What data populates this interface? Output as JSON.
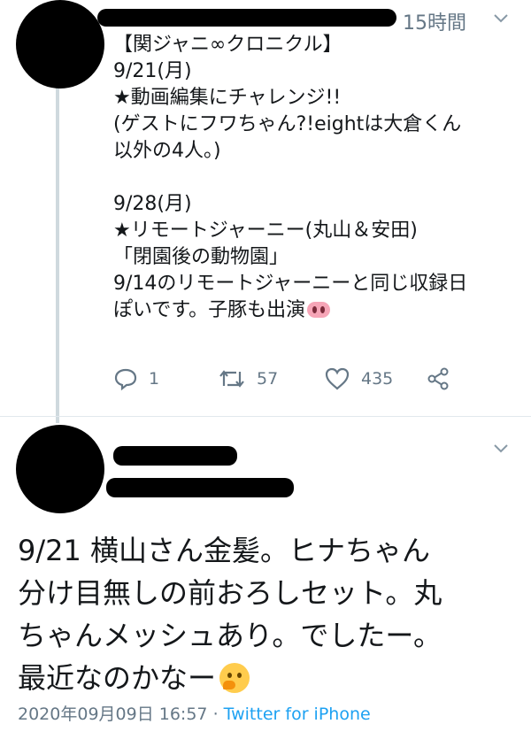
{
  "tweet1": {
    "timestamp": "15時間",
    "lines": [
      "【関ジャニ∞クロニクル】",
      "9/21(月)",
      "★動画編集にチャレンジ!!",
      "(ゲストにフワちゃん?!eightは大倉くん",
      "以外の4人。)",
      "",
      "9/28(月)",
      "★リモートジャーニー(丸山＆安田)",
      "「閉園後の動物園」",
      "9/14のリモートジャーニーと同じ収録日",
      "ぽいです。子豚も出演"
    ],
    "emoji_last_line": "pig-nose",
    "actions": {
      "reply_count": "1",
      "retweet_count": "57",
      "like_count": "435"
    }
  },
  "tweet2": {
    "lines": [
      "9/21 横山さん金髪。ヒナちゃん",
      "分け目無しの前おろしセット。丸",
      "ちゃんメッシュあり。でしたー。",
      "最近なのかなー"
    ],
    "emoji_last_line": "thinking-face",
    "date": "2020年09月09日 16:57",
    "separator": "·",
    "source": "Twitter for iPhone"
  },
  "colors": {
    "text": "#14171a",
    "secondary": "#657786",
    "link": "#1da1f2",
    "divider": "#e1e8ed"
  }
}
